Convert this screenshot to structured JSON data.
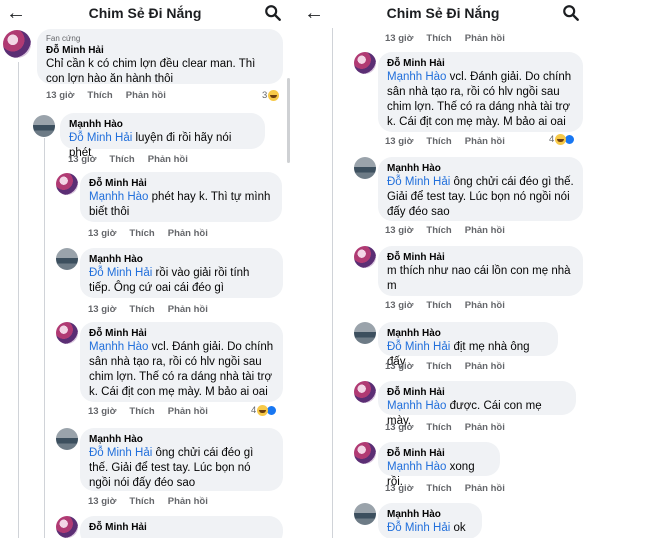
{
  "header": {
    "title": "Chim Sẻ Đi Nắng"
  },
  "labels": {
    "like": "Thích",
    "reply": "Phản hồi"
  },
  "left": {
    "top": {
      "badge": "Fan cứng",
      "name": "Đỗ Minh Hải",
      "text": "Chỉ cần k có chim lợn đều clear man. Thì con lợn hào ăn hành thôi",
      "time": "13 giờ",
      "count": "3"
    },
    "comments": [
      {
        "name": "Mạnhh Hào",
        "mention": "Đỗ Minh Hải",
        "text": " luyện đi rồi hãy nói phét",
        "time": "13 giờ"
      },
      {
        "name": "Đỗ Minh Hải",
        "mention": "Mạnhh Hào",
        "text": " phét hay k. Thì tự mình biết thôi",
        "time": "13 giờ"
      },
      {
        "name": "Mạnhh Hào",
        "mention": "Đỗ Minh Hải",
        "text": " rồi vào giải rồi tính tiếp. Ông cứ oai cái đéo gì",
        "time": "13 giờ"
      },
      {
        "name": "Đỗ Minh Hải",
        "mention": "Mạnhh Hào",
        "text": " vcl. Đánh giải. Do chính sân nhà tạo ra, rồi có hlv ngồi sau chim lợn. Thế có ra dáng nhà tài trợ k. Cái địt con mẹ mày. M bảo ai oai",
        "time": "13 giờ",
        "count": "4"
      },
      {
        "name": "Mạnhh Hào",
        "mention": "Đỗ Minh Hải",
        "text": " ông chửi cái đéo gì thế. Giải để test tay. Lúc bọn nó ngồi nói đấy đéo sao",
        "time": "13 giờ"
      },
      {
        "name": "Đỗ Minh Hải"
      }
    ]
  },
  "right": {
    "top_time": "13 giờ",
    "comments": [
      {
        "name": "Đỗ Minh Hải",
        "mention": "Mạnhh Hào",
        "text": " vcl. Đánh giải. Do chính sân nhà tạo ra, rồi có hlv ngồi sau chim lợn. Thế có ra dáng nhà tài trợ k. Cái địt con mẹ mày. M bảo ai oai",
        "time": "13 giờ",
        "count": "4"
      },
      {
        "name": "Mạnhh Hào",
        "mention": "Đỗ Minh Hải",
        "text": " ông chửi cái đéo gì thế. Giải để test tay. Lúc bọn nó ngồi nói đấy đéo sao",
        "time": "13 giờ"
      },
      {
        "name": "Đỗ Minh Hải",
        "mention": "",
        "text": "m thích như nao cái lồn con mẹ nhà m",
        "time": "13 giờ"
      },
      {
        "name": "Mạnhh Hào",
        "mention": "Đỗ Minh Hải",
        "text": " địt mẹ nhà ông đấy",
        "time": "13 giờ"
      },
      {
        "name": "Đỗ Minh Hải",
        "mention": "Mạnhh Hào",
        "text": " được. Cái con mẹ mày.",
        "time": "13 giờ"
      },
      {
        "name": "Đỗ Minh Hải",
        "mention": "Mạnhh Hào",
        "text": " xong rồi.",
        "time": "13 giờ"
      },
      {
        "name": "Mạnhh Hào",
        "mention": "Đỗ Minh Hải",
        "text": " ok a"
      }
    ]
  }
}
